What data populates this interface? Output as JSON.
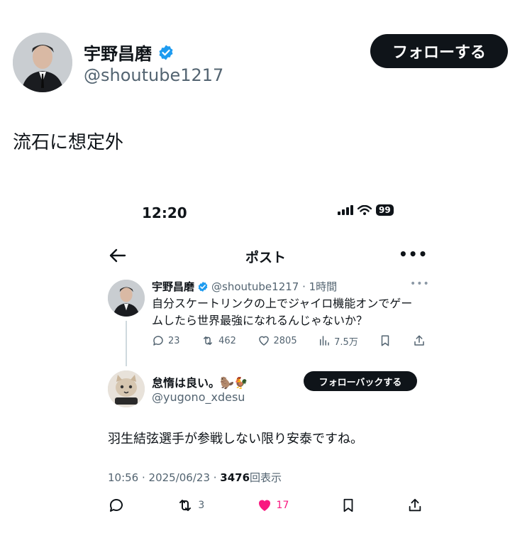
{
  "post": {
    "author_name": "宇野昌磨",
    "handle": "@shoutube1217",
    "follow_label": "フォローする",
    "text": "流石に想定外"
  },
  "embedded": {
    "status_time": "12:20",
    "battery": "99",
    "nav_title": "ポスト",
    "quoted": {
      "author_name": "宇野昌磨",
      "meta": "@shoutube1217 · 1時間",
      "text": "自分スケートリンクの上でジャイロ機能オンでゲームしたら世界最強になれるんじゃないか？",
      "replies": "23",
      "reposts": "462",
      "likes": "2805",
      "views": "7.5万"
    },
    "reply": {
      "author_name": "怠惰は良い。🦫🐓",
      "handle": "@yugono_xdesu",
      "follow_label": "フォローバックする",
      "text": "羽生結弦選手が参戦しない限り安泰ですね。",
      "time": "10:56 · 2025/06/23 · ",
      "views_count": "3476",
      "views_label": "回表示",
      "reposts": "3",
      "likes": "17"
    }
  },
  "colors": {
    "verified": "#1d9bf0",
    "like": "#f91880",
    "text": "#0f1419",
    "secondary": "#536471"
  }
}
